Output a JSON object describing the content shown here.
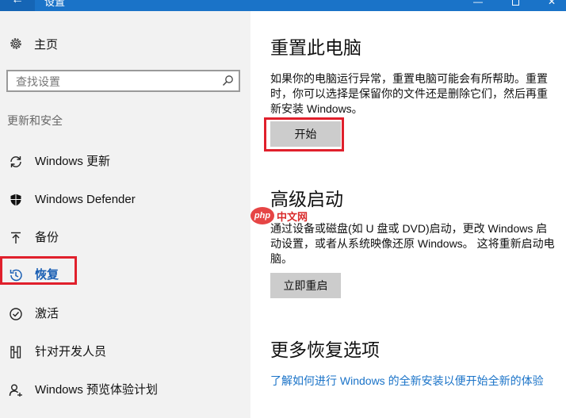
{
  "window": {
    "title": "设置",
    "back_glyph": "←",
    "minimize_glyph": "—",
    "close_glyph": "✕"
  },
  "sidebar": {
    "home_label": "主页",
    "search_placeholder": "查找设置",
    "section_label": "更新和安全",
    "items": [
      {
        "label": "Windows 更新",
        "icon": "sync-icon"
      },
      {
        "label": "Windows Defender",
        "icon": "shield-icon"
      },
      {
        "label": "备份",
        "icon": "upload-icon"
      },
      {
        "label": "恢复",
        "icon": "history-icon",
        "selected": true
      },
      {
        "label": "激活",
        "icon": "check-circle-icon"
      },
      {
        "label": "针对开发人员",
        "icon": "developer-tools-icon"
      },
      {
        "label": "Windows 预览体验计划",
        "icon": "insider-icon"
      }
    ]
  },
  "main": {
    "reset": {
      "title": "重置此电脑",
      "description": "如果你的电脑运行异常，重置电脑可能会有所帮助。重置时，你可以选择是保留你的文件还是删除它们，然后再重新安装 Windows。",
      "button_label": "开始"
    },
    "advanced": {
      "title": "高级启动",
      "description": "通过设备或磁盘(如 U 盘或 DVD)启动，更改 Windows 启动设置，或者从系统映像还原 Windows。 这将重新启动电脑。",
      "button_label": "立即重启"
    },
    "more": {
      "title": "更多恢复选项",
      "link": "了解如何进行 Windows 的全新安装以便开始全新的体验"
    }
  },
  "watermark": {
    "logo_text": "php",
    "text": "中文网"
  },
  "colors": {
    "accent": "#1a73c8",
    "highlight_border": "#e0202c",
    "sidebar_bg": "#f2f2f2",
    "button_bg": "#cccccc"
  }
}
